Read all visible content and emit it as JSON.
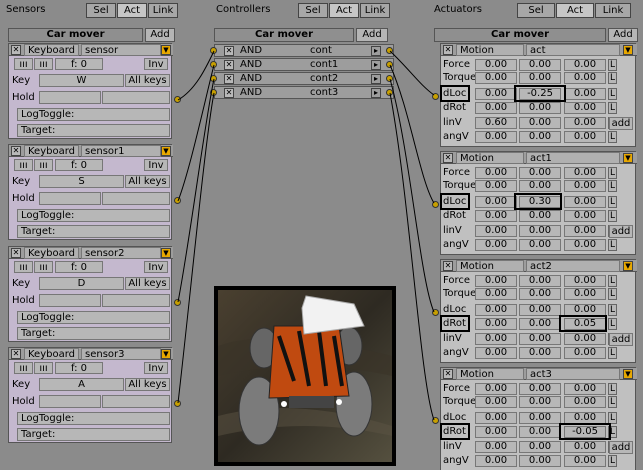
{
  "header": {
    "sensors_title": "Sensors",
    "controllers_title": "Controllers",
    "actuators_title": "Actuators",
    "sel": "Sel",
    "act": "Act",
    "link": "Link"
  },
  "object_name": "Car mover",
  "add_label": "Add",
  "sensors": [
    {
      "type": "Keyboard",
      "name": "sensor",
      "freq": "f: 0",
      "inv": "Inv",
      "key_label": "Key",
      "key": "W",
      "allkeys": "All keys",
      "hold_label": "Hold",
      "logtoggle": "LogToggle:",
      "target": "Target:"
    },
    {
      "type": "Keyboard",
      "name": "sensor1",
      "freq": "f: 0",
      "inv": "Inv",
      "key_label": "Key",
      "key": "S",
      "allkeys": "All keys",
      "hold_label": "Hold",
      "logtoggle": "LogToggle:",
      "target": "Target:"
    },
    {
      "type": "Keyboard",
      "name": "sensor2",
      "freq": "f: 0",
      "inv": "Inv",
      "key_label": "Key",
      "key": "D",
      "allkeys": "All keys",
      "hold_label": "Hold",
      "logtoggle": "LogToggle:",
      "target": "Target:"
    },
    {
      "type": "Keyboard",
      "name": "sensor3",
      "freq": "f: 0",
      "inv": "Inv",
      "key_label": "Key",
      "key": "A",
      "allkeys": "All keys",
      "hold_label": "Hold",
      "logtoggle": "LogToggle:",
      "target": "Target:"
    }
  ],
  "controllers": [
    {
      "type": "AND",
      "name": "cont"
    },
    {
      "type": "AND",
      "name": "cont1"
    },
    {
      "type": "AND",
      "name": "cont2"
    },
    {
      "type": "AND",
      "name": "cont3"
    }
  ],
  "actuators": [
    {
      "type": "Motion",
      "name": "act",
      "rows": [
        {
          "label": "Force",
          "v": [
            "0.00",
            "0.00",
            "0.00"
          ],
          "l": "L"
        },
        {
          "label": "Torque",
          "v": [
            "0.00",
            "0.00",
            "0.00"
          ],
          "l": "L"
        },
        {
          "label": "dLoc",
          "v": [
            "0.00",
            "-0.25",
            "0.00"
          ],
          "l": "L"
        },
        {
          "label": "dRot",
          "v": [
            "0.00",
            "0.00",
            "0.00"
          ],
          "l": "L"
        },
        {
          "label": "linV",
          "v": [
            "0.60",
            "0.00",
            "0.00"
          ],
          "l": "L"
        },
        {
          "label": "angV",
          "v": [
            "0.00",
            "0.00",
            "0.00"
          ],
          "l": "L"
        }
      ]
    },
    {
      "type": "Motion",
      "name": "act1",
      "rows": [
        {
          "label": "Force",
          "v": [
            "0.00",
            "0.00",
            "0.00"
          ],
          "l": "L"
        },
        {
          "label": "Torque",
          "v": [
            "0.00",
            "0.00",
            "0.00"
          ],
          "l": "L"
        },
        {
          "label": "dLoc",
          "v": [
            "0.00",
            "0.30",
            "0.00"
          ],
          "l": "L"
        },
        {
          "label": "dRot",
          "v": [
            "0.00",
            "0.00",
            "0.00"
          ],
          "l": "L"
        },
        {
          "label": "linV",
          "v": [
            "0.00",
            "0.00",
            "0.00"
          ],
          "l": "L"
        },
        {
          "label": "angV",
          "v": [
            "0.00",
            "0.00",
            "0.00"
          ],
          "l": "L"
        }
      ]
    },
    {
      "type": "Motion",
      "name": "act2",
      "rows": [
        {
          "label": "Force",
          "v": [
            "0.00",
            "0.00",
            "0.00"
          ],
          "l": "L"
        },
        {
          "label": "Torque",
          "v": [
            "0.00",
            "0.00",
            "0.00"
          ],
          "l": "L"
        },
        {
          "label": "dLoc",
          "v": [
            "0.00",
            "0.00",
            "0.00"
          ],
          "l": "L"
        },
        {
          "label": "dRot",
          "v": [
            "0.00",
            "0.00",
            "0.05"
          ],
          "l": "L"
        },
        {
          "label": "linV",
          "v": [
            "0.00",
            "0.00",
            "0.00"
          ],
          "l": "L"
        },
        {
          "label": "angV",
          "v": [
            "0.00",
            "0.00",
            "0.00"
          ],
          "l": "L"
        }
      ]
    },
    {
      "type": "Motion",
      "name": "act3",
      "rows": [
        {
          "label": "Force",
          "v": [
            "0.00",
            "0.00",
            "0.00"
          ],
          "l": "L"
        },
        {
          "label": "Torque",
          "v": [
            "0.00",
            "0.00",
            "0.00"
          ],
          "l": "L"
        },
        {
          "label": "dLoc",
          "v": [
            "0.00",
            "0.00",
            "0.00"
          ],
          "l": "L"
        },
        {
          "label": "dRot",
          "v": [
            "0.00",
            "0.00",
            "-0.05"
          ],
          "l": "L"
        },
        {
          "label": "linV",
          "v": [
            "0.00",
            "0.00",
            "0.00"
          ],
          "l": "L"
        },
        {
          "label": "angV",
          "v": [
            "0.00",
            "0.00",
            "0.00"
          ],
          "l": "L"
        }
      ]
    }
  ],
  "add_small": "add",
  "colors": {
    "bg": "#8b8b8b",
    "sensor": "#c4b8ce",
    "actuator": "#c0c0c0",
    "connector": "#c8a000"
  }
}
